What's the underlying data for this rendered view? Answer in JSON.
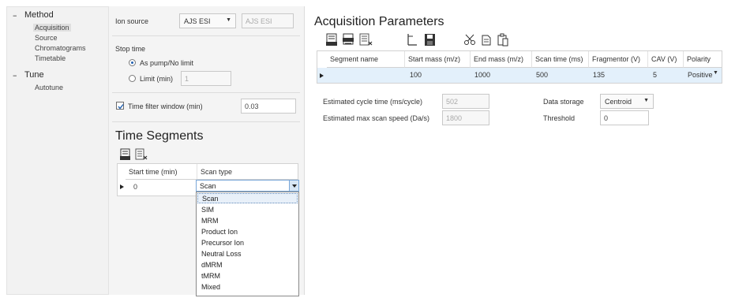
{
  "tree": {
    "groups": [
      {
        "label": "Method",
        "children": [
          "Acquisition",
          "Source",
          "Chromatograms",
          "Timetable"
        ]
      },
      {
        "label": "Tune",
        "children": [
          "Autotune"
        ]
      }
    ]
  },
  "source": {
    "label": "Ion source",
    "selected": "AJS ESI",
    "readonly": "AJS ESI"
  },
  "stop_time": {
    "label": "Stop time",
    "option_pump": "As pump/No limit",
    "option_limit": "Limit (min)",
    "limit_value": "1"
  },
  "time_filter": {
    "label": "Time filter window (min)",
    "value": "0.03",
    "checked": true
  },
  "segments": {
    "title": "Time Segments",
    "headers": [
      "Start time (min)",
      "Scan type"
    ],
    "row": {
      "start": "0",
      "scan_type": "Scan"
    },
    "options": [
      "Scan",
      "SIM",
      "MRM",
      "Product Ion",
      "Precursor Ion",
      "Neutral Loss",
      "dMRM",
      "tMRM",
      "Mixed"
    ],
    "selected_option": "Scan"
  },
  "acquisition": {
    "title": "Acquisition Parameters",
    "headers": [
      "Segment name",
      "Start mass (m/z)",
      "End mass (m/z)",
      "Scan time (ms)",
      "Fragmentor (V)",
      "CAV (V)",
      "Polarity"
    ],
    "row": [
      "",
      "100",
      "1000",
      "500",
      "135",
      "5",
      "Positive"
    ],
    "cycle_time_label": "Estimated cycle time (ms/cycle)",
    "cycle_time_value": "502",
    "scan_speed_label": "Estimated max scan speed (Da/s)",
    "scan_speed_value": "1800",
    "storage_label": "Data storage",
    "storage_value": "Centroid",
    "threshold_label": "Threshold",
    "threshold_value": "0"
  }
}
